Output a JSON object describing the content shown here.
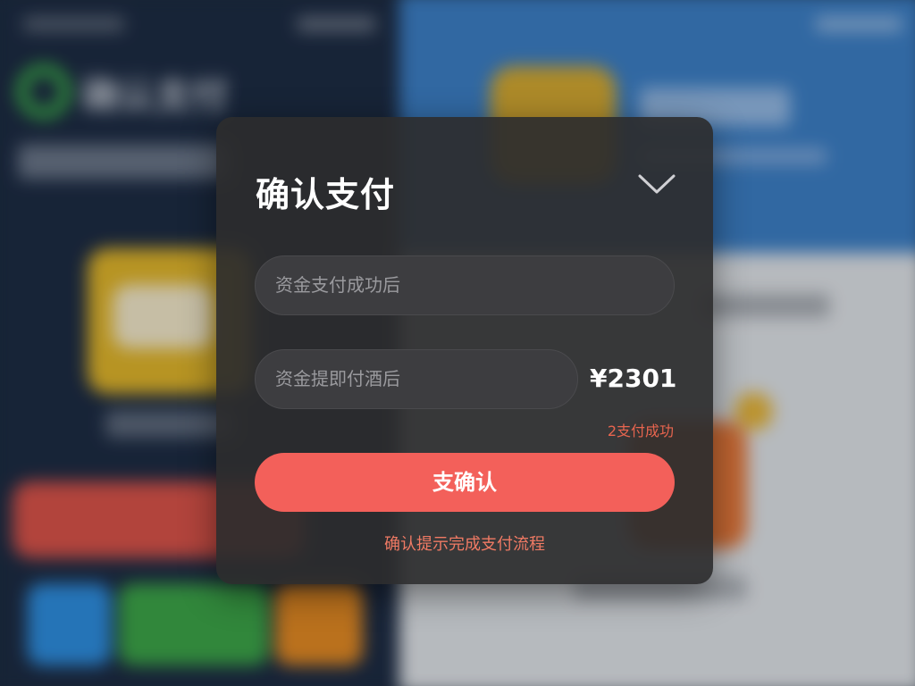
{
  "background": {
    "left_logo_text": "确认支付"
  },
  "modal": {
    "title": "确认支付",
    "collapse_icon": "chevron-down-icon",
    "field_1_placeholder": "资金支付成功后",
    "field_2_placeholder": "资金提即付酒后",
    "amount": "¥2301",
    "hint": "2支付成功",
    "confirm_label": "支确认",
    "footer_link": "确认提示完成支付流程",
    "accent_color": "#f3605a"
  }
}
